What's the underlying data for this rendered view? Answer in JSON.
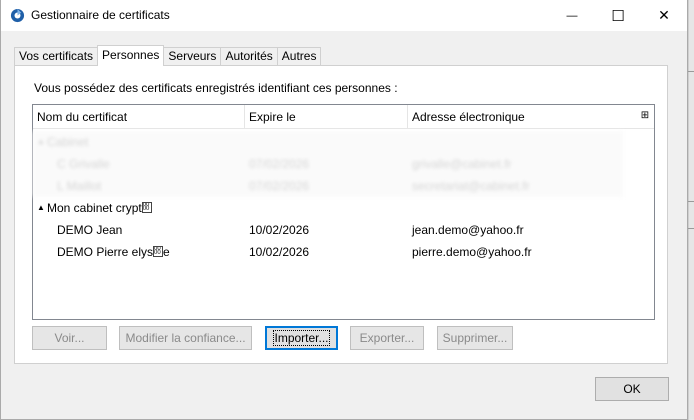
{
  "window": {
    "title": "Gestionnaire de certificats",
    "minimize_glyph": "—",
    "maximize_glyph": "☐",
    "close_glyph": "✕"
  },
  "tabs": [
    {
      "label": "Vos certificats",
      "active": false
    },
    {
      "label": "Personnes",
      "active": true
    },
    {
      "label": "Serveurs",
      "active": false
    },
    {
      "label": "Autorités",
      "active": false
    },
    {
      "label": "Autres",
      "active": false
    }
  ],
  "panel": {
    "description": "Vous possédez des certificats enregistrés identifiant ces personnes :"
  },
  "tree": {
    "columns": [
      "Nom du certificat",
      "Expire le",
      "Adresse électronique"
    ],
    "column_picker_glyph": "⊞",
    "faded_group": {
      "name": "Cabinet",
      "rows": [
        {
          "name": "C Grivalle",
          "date": "07/02/2026",
          "email": "grivalle@cabinet.fr"
        },
        {
          "name": "L Maillot",
          "date": "07/02/2026",
          "email": "secretariat@cabinet.fr"
        }
      ]
    },
    "group": {
      "name_prefix": "Mon cabinet crypt",
      "twisty": "▲",
      "rows": [
        {
          "name": "DEMO Jean",
          "name_suffix": "",
          "date": "10/02/2026",
          "email": "jean.demo@yahoo.fr"
        },
        {
          "name": "DEMO Pierre elys",
          "name_suffix": "e",
          "date": "10/02/2026",
          "email": "pierre.demo@yahoo.fr"
        }
      ]
    }
  },
  "buttons": {
    "view": "Voir...",
    "modify_trust": "Modifier la confiance...",
    "import": "Importer...",
    "export": "Exporter...",
    "delete": "Supprimer...",
    "ok": "OK"
  },
  "colors": {
    "accent": "#0078d7",
    "app_icon": "#1f5fa8"
  }
}
